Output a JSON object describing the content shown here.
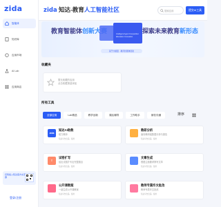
{
  "sidebar": {
    "logo": "zida",
    "items": [
      {
        "label": "智能体",
        "icon": "home-icon",
        "active": true
      },
      {
        "label": "知识库",
        "icon": "book-icon",
        "active": false
      },
      {
        "label": "应用市场",
        "icon": "store-icon",
        "active": false
      },
      {
        "label": "AI Lab",
        "icon": "lab-icon",
        "active": false
      },
      {
        "label": "应用商店",
        "icon": "grid-icon",
        "active": false
      }
    ],
    "promo": "扫码加入知达官方交流群",
    "login_label": "登录/注册"
  },
  "header": {
    "brand": "zida",
    "title_text": " 知达-教育",
    "title_highlight": "人工智能社区",
    "search_placeholder": "搜索应用",
    "submit_label": "提交AI工具"
  },
  "banner": {
    "left_text": "教育智能体",
    "left_highlight": "创新大赛",
    "right_text": "探索未来教育",
    "right_highlight": "新形态",
    "caption_1": "Intelligent Agent Competition",
    "caption_2": "Education Innovation",
    "pill": "基于大模型 · 教育智能体创新"
  },
  "favorites": {
    "title": "收藏夹",
    "empty_line1": "暂无收藏的应用",
    "empty_line2": "点击收藏按钮添加"
  },
  "tools": {
    "title": "所有工具",
    "tabs": [
      "全部应用",
      "Lab精选",
      "教学创新",
      "课后辅导",
      "工作助手",
      "家校沟通"
    ],
    "sort_label": "排序",
    "cards": [
      {
        "name": "知达AI助教",
        "desc": "助力教师",
        "meta": "知达平台出品 · 使用",
        "icon_label": "zida",
        "color": "#2b5df5"
      },
      {
        "name": "教研分析",
        "desc": "面向教研组数据分析与报告",
        "meta": "知达平台出品 · 使用",
        "icon_label": "",
        "color": "#ffb040"
      },
      {
        "name": "试卷扩写",
        "desc": "给出试题扩写出完整题目",
        "meta": "知达平台出品 · 使用",
        "icon_label": "T",
        "color": "#ff8a6a"
      },
      {
        "name": "文章生成",
        "desc": "根据主题要求撰写文章",
        "meta": "知达平台出品 · 使用",
        "icon_label": "",
        "color": "#5a8cff"
      },
      {
        "name": "公开课教案",
        "desc": "一键生成公开课教案",
        "meta": "知达平台出品 · 使用",
        "icon_label": "",
        "color": "#ff6a8a"
      },
      {
        "name": "教师专属作文批改",
        "desc": "教师专属作文批改",
        "meta": "知达平台出品 · 使用",
        "icon_label": "",
        "color": "#ff7aa0"
      }
    ]
  }
}
